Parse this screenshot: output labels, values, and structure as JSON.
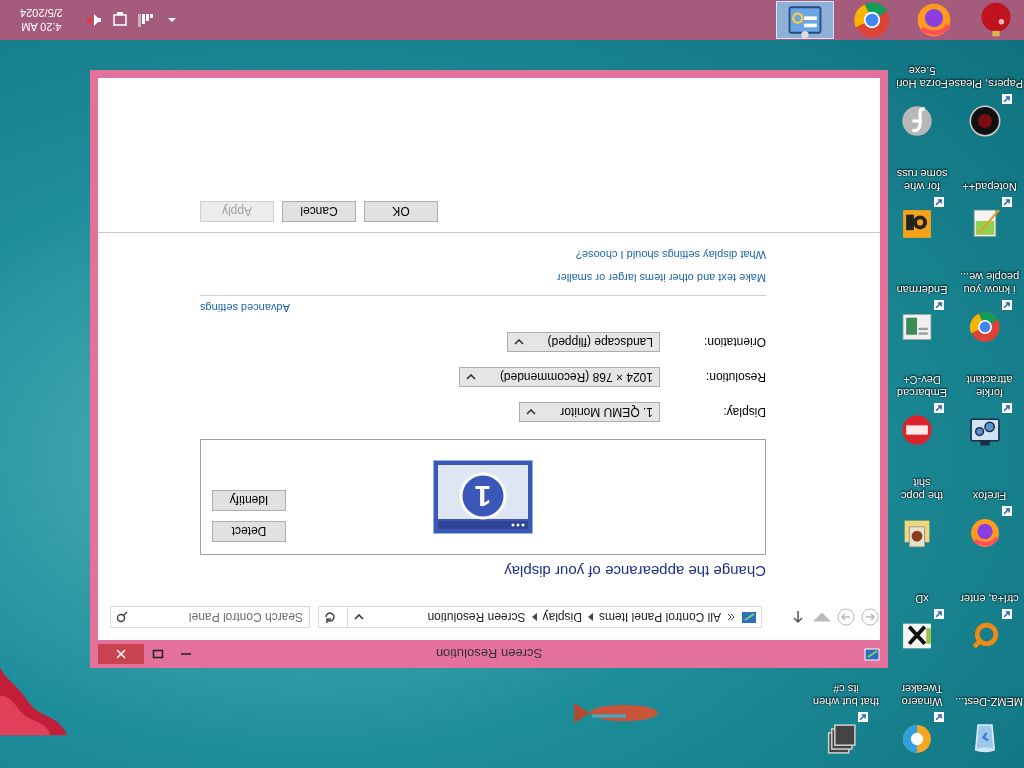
{
  "desktop": {
    "icon_columns": [
      [
        {
          "kind": "recycle-bin",
          "label_lines": [
            "MEMZ-Dest..."
          ],
          "shortcut": false
        },
        {
          "kind": "orange-ring",
          "label_lines": [
            "ctrl+a, enter"
          ],
          "shortcut": true
        },
        {
          "kind": "firefox",
          "label_lines": [
            "Firefox"
          ],
          "shortcut": true
        },
        {
          "kind": "gear-screen",
          "label_lines": [
            "forkie",
            "attractant"
          ],
          "shortcut": true
        },
        {
          "kind": "chrome",
          "label_lines": [
            "i know you",
            "people we..."
          ],
          "shortcut": true
        },
        {
          "kind": "notepad",
          "label_lines": [
            "Notepad++"
          ],
          "shortcut": true
        },
        {
          "kind": "dark-disc",
          "label_lines": [
            "Papers, Please"
          ],
          "shortcut": true
        }
      ],
      [
        {
          "kind": "swirl",
          "label_lines": [
            "Winaero",
            "Tweaker"
          ],
          "shortcut": true
        },
        {
          "kind": "hex-x",
          "label_lines": [
            "xD"
          ],
          "shortcut": true
        },
        {
          "kind": "folder-picture",
          "label_lines": [
            "the popc",
            "shit"
          ],
          "shortcut": false
        },
        {
          "kind": "dev-badge",
          "label_lines": [
            "Embarcad",
            "Dev-C+"
          ],
          "shortcut": true
        },
        {
          "kind": "window-picture",
          "label_lines": [
            "Enderman"
          ],
          "shortcut": true
        },
        {
          "kind": "orange-tile",
          "label_lines": [
            "for whe",
            "some russ"
          ],
          "shortcut": true
        },
        {
          "kind": "silver-disc",
          "label_lines": [
            "Forza Hori",
            "5.exe"
          ],
          "shortcut": false
        }
      ],
      [
        {
          "kind": "stack",
          "label_lines": [
            "that but when",
            "its c#"
          ],
          "shortcut": true
        }
      ]
    ]
  },
  "window": {
    "title": "Screen Resolution",
    "address": {
      "items": [
        "All Control Panel Items",
        "Display",
        "Screen Resolution"
      ],
      "search_placeholder": "Search Control Panel"
    },
    "heading": "Change the appearance of your display",
    "monitor_number": "1",
    "side_buttons": [
      "Detect",
      "Identify"
    ],
    "settings": [
      {
        "label": "Display:",
        "value": "1. QEMU Monitor"
      },
      {
        "label": "Resolution:",
        "value": "1024 × 768 (Recommended)"
      },
      {
        "label": "Orientation:",
        "value": "Landscape (flipped)"
      }
    ],
    "advanced_link": "Advanced settings",
    "links": [
      "Make text and other items larger or smaller",
      "What display settings should I choose?"
    ],
    "buttons": [
      {
        "label": "OK",
        "disabled": false
      },
      {
        "label": "Cancel",
        "disabled": false
      },
      {
        "label": "Apply",
        "disabled": true
      }
    ]
  },
  "taskbar": {
    "apps": [
      {
        "kind": "ornament",
        "selected": false
      },
      {
        "kind": "firefox",
        "selected": false
      },
      {
        "kind": "chrome",
        "selected": false
      },
      {
        "kind": "control-panel",
        "selected": true
      }
    ],
    "time": "4:20 AM",
    "date": "2/5/2024"
  }
}
